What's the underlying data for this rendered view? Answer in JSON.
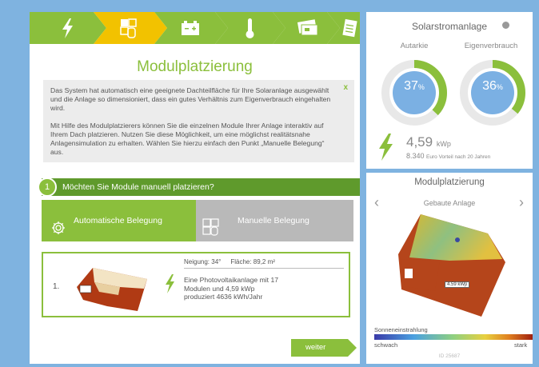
{
  "title": "Modulplatzierung",
  "info": {
    "paragraph1": "Das System hat automatisch eine geeignete Dachteilfläche für Ihre Solaranlage ausgewählt und die Anlage so dimensioniert, dass ein gutes Verhältnis zum Eigenverbrauch eingehalten wird.",
    "paragraph2": "Mit Hilfe des Modulplatzierers können Sie die einzelnen Module Ihrer Anlage interaktiv auf Ihrem Dach platzieren. Nutzen Sie diese Möglichkeit, um eine möglichst realitätsnahe Anlagensimulation zu erhalten. Wählen Sie hierzu einfach den Punkt „Manuelle Belegung“ aus.",
    "close": "x"
  },
  "question": {
    "number": "1",
    "text": "Möchten Sie Module manuell platzieren?"
  },
  "choices": {
    "auto": "Automatische Belegung",
    "manual": "Manuelle Belegung"
  },
  "result": {
    "number": "1.",
    "neigung": "Neigung: 34°",
    "flaeche": "Fläche: 89,2 m²",
    "description": "Eine Photovoltaikanlage mit 17 Modulen und 4,59 kWp produziert 4636 kWh/Jahr"
  },
  "weiter": "weiter",
  "solar": {
    "title": "Solarstromanlage",
    "autarkie_label": "Autarkie",
    "eigen_label": "Eigenverbrauch",
    "autarkie_value": "37",
    "eigen_value": "36",
    "percent": "%",
    "autarkie_fraction": 0.37,
    "eigen_fraction": 0.36,
    "kwp_value": "4,59",
    "kwp_unit": "kWp",
    "euro_value": "8.340",
    "euro_text": "Euro Vorteil nach 20 Jahren"
  },
  "placement": {
    "title": "Modulplatzierung",
    "subtitle": "Gebaute Anlage",
    "roof_label": "4.59 kWp",
    "legend_label": "Sonneneinstrahlung",
    "legend_low": "schwach",
    "legend_high": "stark",
    "id": "ID 25687"
  },
  "colors": {
    "green": "#8bbf3c",
    "dark_green": "#5f9a2c",
    "gauge_fill": "#7bb0e3",
    "gauge_track": "#e8e8e8",
    "background": "#7fb3e0"
  }
}
